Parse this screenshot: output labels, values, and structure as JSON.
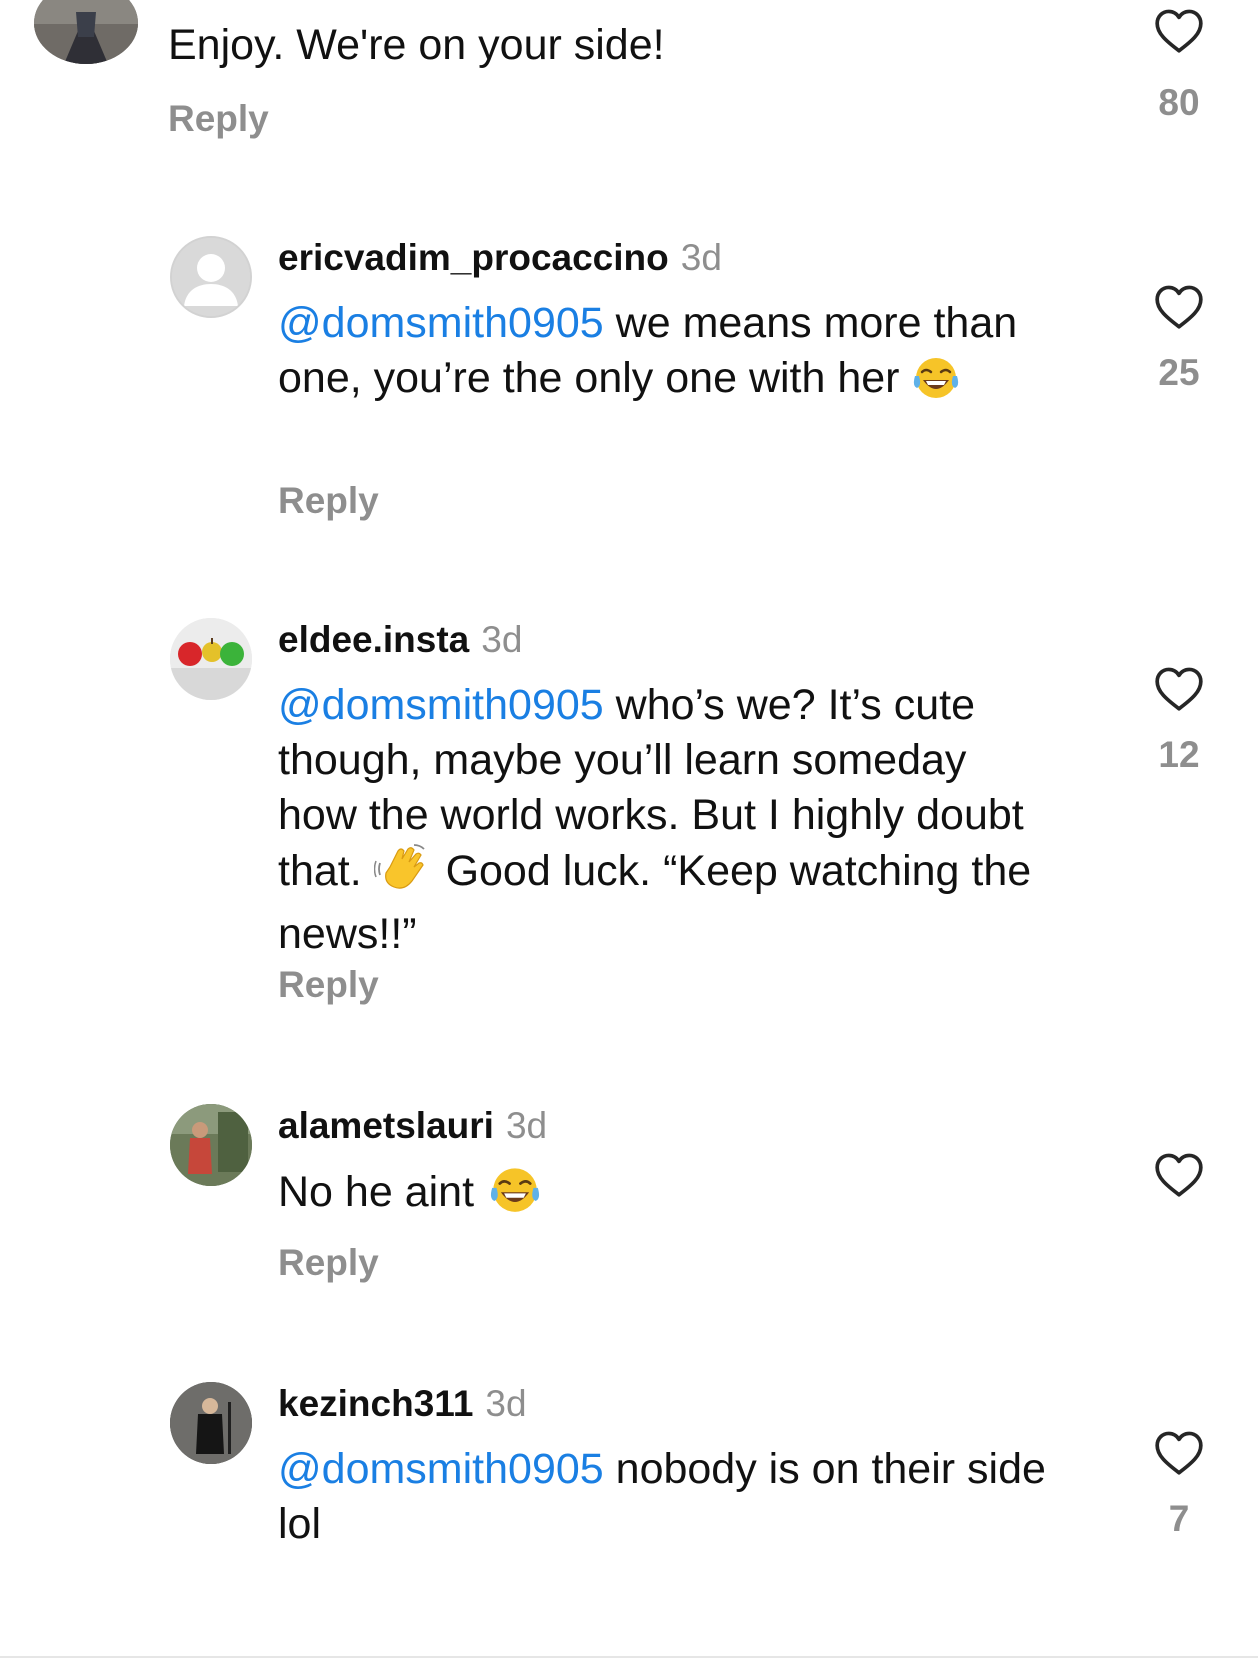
{
  "comments": [
    {
      "text": "Enjoy. We're on your side!",
      "reply_label": "Reply",
      "likes": "80"
    },
    {
      "username": "ericvadim_procaccino",
      "time": "3d",
      "mention": "@domsmith0905",
      "text_1": " we means more than one, you’re the only one with her ",
      "emoji": "face-with-tears-of-joy",
      "reply_label": "Reply",
      "likes": "25"
    },
    {
      "username": "eldee.insta",
      "time": "3d",
      "mention": "@domsmith0905",
      "text_1": " who’s we? It’s cute though, maybe you’ll learn someday how the world works. But I highly doubt that. ",
      "emoji": "waving-hand",
      "text_2": " Good luck. “Keep watching the news!!”",
      "reply_label": "Reply",
      "likes": "12"
    },
    {
      "username": "alametslauri",
      "time": "3d",
      "text_1": "No he aint ",
      "emoji": "face-with-tears-of-joy",
      "reply_label": "Reply",
      "likes": ""
    },
    {
      "username": "kezinch311",
      "time": "3d",
      "mention": "@domsmith0905",
      "text_1": " nobody is on their side lol",
      "likes": "7"
    }
  ],
  "icons": {
    "like": "heart-outline-icon"
  },
  "colors": {
    "mention": "#1a7fe3",
    "secondary_text": "#8e8e8e",
    "heart_stroke": "#262626"
  }
}
